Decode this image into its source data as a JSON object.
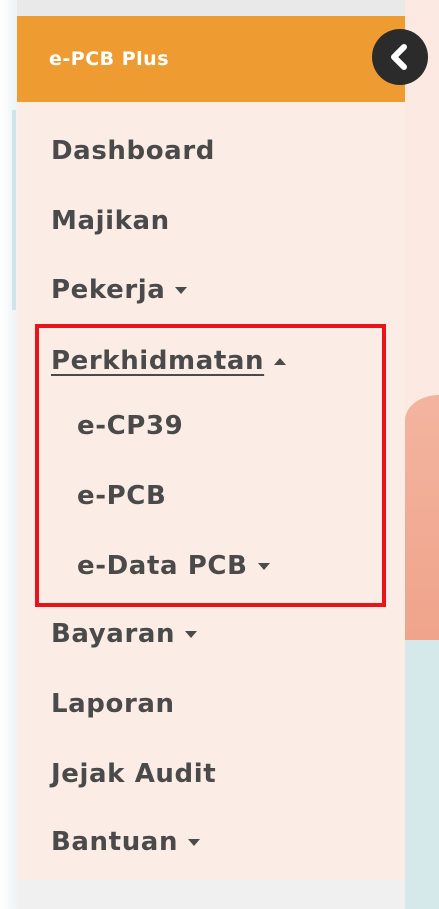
{
  "brand": {
    "title": "e-PCB Plus"
  },
  "collapse_button": {
    "icon": "chevron-left-icon"
  },
  "nav": {
    "items": [
      {
        "label": "Dashboard",
        "caret": ""
      },
      {
        "label": "Majikan",
        "caret": ""
      },
      {
        "label": "Pekerja",
        "caret": "down"
      },
      {
        "label": "Perkhidmatan",
        "caret": "up",
        "active": true,
        "subitems": [
          {
            "label": "e-CP39",
            "caret": ""
          },
          {
            "label": "e-PCB",
            "caret": ""
          },
          {
            "label": "e-Data PCB",
            "caret": "down"
          }
        ]
      },
      {
        "label": "Bayaran",
        "caret": "down"
      },
      {
        "label": "Laporan",
        "caret": ""
      },
      {
        "label": "Jejak Audit",
        "caret": ""
      },
      {
        "label": "Bantuan",
        "caret": "down"
      }
    ]
  },
  "colors": {
    "brand_bar": "#ee9c32",
    "sidebar_bg": "#fcece6",
    "nav_text": "#4a4a4a",
    "highlight": "#e8141a",
    "collapse_button": "#2b2b2b"
  }
}
